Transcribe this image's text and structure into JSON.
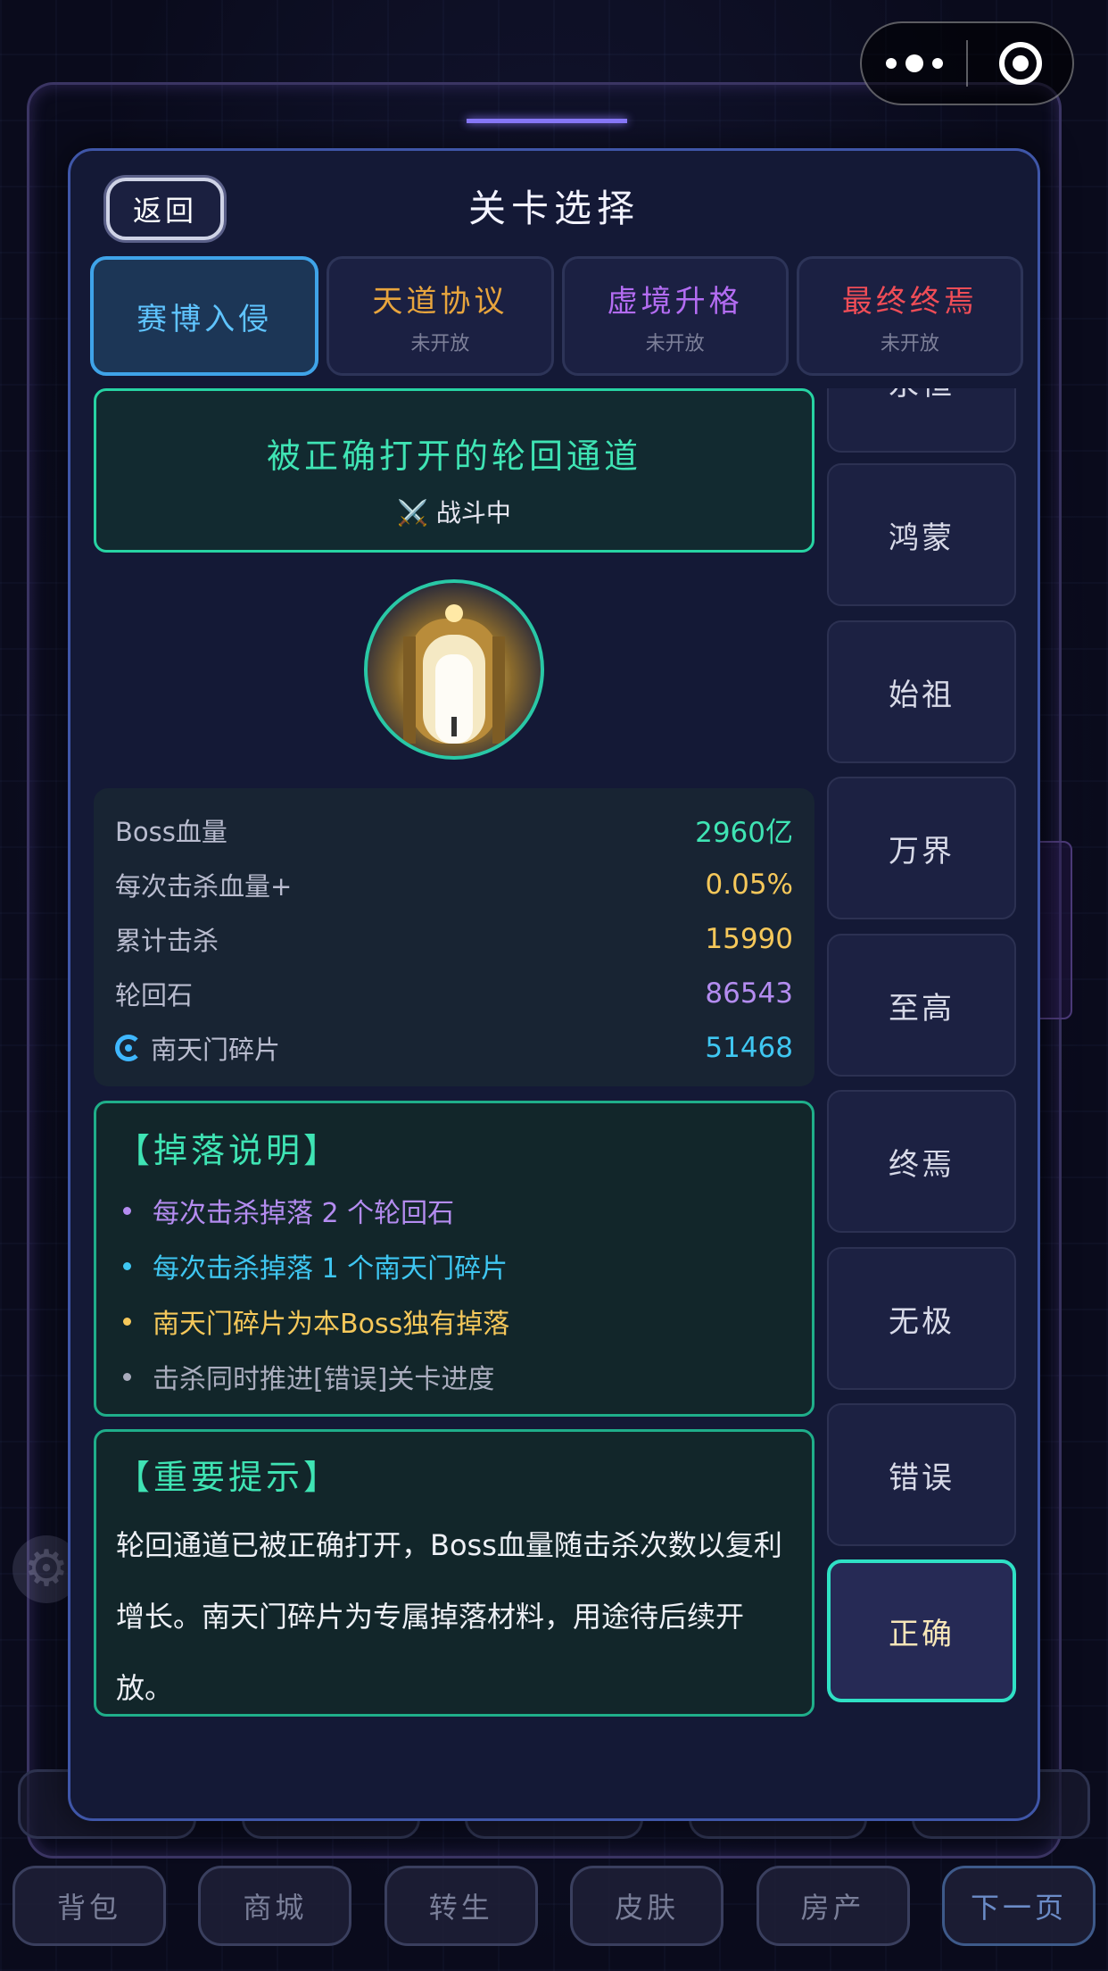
{
  "capsule": {
    "more_icon": "more-dots-icon",
    "close_icon": "target-close-icon"
  },
  "modal": {
    "back_label": "返回",
    "title": "关卡选择"
  },
  "tabs": [
    {
      "name": "赛博入侵",
      "sub": "",
      "color": "#5fc4ff",
      "active": true
    },
    {
      "name": "天道协议",
      "sub": "未开放",
      "color": "#e8a53d",
      "active": false
    },
    {
      "name": "虚境升格",
      "sub": "未开放",
      "color": "#b36cf2",
      "active": false
    },
    {
      "name": "最终终焉",
      "sub": "未开放",
      "color": "#f04d57",
      "active": false
    }
  ],
  "stage": {
    "title": "被正确打开的轮回通道",
    "status_icon": "crossed-swords-icon",
    "status": "战斗中"
  },
  "stats": [
    {
      "label": "Boss血量",
      "value": "2960亿",
      "color": "#3fe4b4"
    },
    {
      "label": "每次击杀血量+",
      "value": "0.05%",
      "color": "#f6c85a"
    },
    {
      "label": "累计击杀",
      "value": "15990",
      "color": "#f6c85a"
    },
    {
      "label": "轮回石",
      "value": "86543",
      "color": "#b48cf0"
    },
    {
      "label": "南天门碎片",
      "value": "51468",
      "color": "#3fc7f2",
      "icon": "swirl-icon"
    }
  ],
  "drops": {
    "title": "【掉落说明】",
    "items": [
      {
        "text": "每次击杀掉落 2 个轮回石",
        "color": "#b48cf0"
      },
      {
        "text": "每次击杀掉落 1 个南天门碎片",
        "color": "#3fc7f2"
      },
      {
        "text": "南天门碎片为本Boss独有掉落",
        "color": "#f6c85a"
      },
      {
        "text": "击杀同时推进[错误]关卡进度",
        "color": "#a9acbd"
      }
    ]
  },
  "notice": {
    "title": "【重要提示】",
    "text": "轮回通道已被正确打开，Boss血量随击杀次数以复利增长。南天门碎片为专属掉落材料，用途待后续开放。"
  },
  "side_items": [
    {
      "label": "永恒",
      "active": false
    },
    {
      "label": "鸿蒙",
      "active": false
    },
    {
      "label": "始祖",
      "active": false
    },
    {
      "label": "万界",
      "active": false
    },
    {
      "label": "至高",
      "active": false
    },
    {
      "label": "终焉",
      "active": false
    },
    {
      "label": "无极",
      "active": false
    },
    {
      "label": "错误",
      "active": false
    },
    {
      "label": "正确",
      "active": true
    }
  ],
  "bottom_nav": [
    "背包",
    "商城",
    "转生",
    "皮肤",
    "房产",
    "下一页"
  ]
}
